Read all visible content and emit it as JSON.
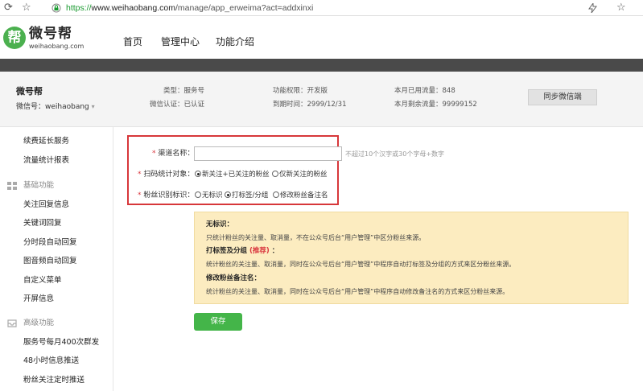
{
  "browser": {
    "back_glyph": "⟳",
    "star_glyph": "☆",
    "url_https": "https://",
    "url_host": "www.weihaobang.com",
    "url_path": "/manage/app_erweima?act=addxinxi",
    "icons": [
      "refresh-icon",
      "bookmark-star-icon",
      "secure-lock-icon",
      "share-icon",
      "star-icon"
    ]
  },
  "header": {
    "logo_glyph": "帮",
    "logo_name": "微号帮",
    "logo_sub": "weihaobang.com",
    "nav": [
      "首页",
      "管理中心",
      "功能介绍"
    ]
  },
  "account": {
    "name": "微号帮",
    "wechat_id": "微信号：weihaobang",
    "type": "类型：服务号",
    "verify": "微信认证：已认证",
    "permission": "功能权限：开发版",
    "expire": "到期时间：2999/12/31",
    "used_traffic": "本月已用流量：848",
    "remain_traffic": "本月剩余流量：99999152",
    "sync_button": "同步微信端"
  },
  "sidebar": {
    "top_items": [
      "续费延长服务",
      "流量统计报表"
    ],
    "group_basic": "基础功能",
    "basic_items": [
      "关注回复信息",
      "关键词回复",
      "分时段自动回复",
      "图音频自动回复",
      "自定义菜单",
      "开屏信息"
    ],
    "group_advanced": "高级功能",
    "advanced_items": [
      "服务号每月400次群发",
      "48小时信息推送",
      "粉丝关注定时推送"
    ]
  },
  "form": {
    "channel_label": "渠道名称：",
    "channel_value": "",
    "channel_hint": "不超过10个汉字或30个字母+数字",
    "target_label": "扫码统计对象：",
    "target_options": [
      "新关注+已关注的粉丝",
      "仅新关注的粉丝"
    ],
    "target_selected": 0,
    "mark_label": "粉丝识别标识：",
    "mark_options": [
      "无标识",
      "打标签/分组",
      "修改粉丝备注名"
    ],
    "mark_selected": 1,
    "required_mark": "*"
  },
  "explain": {
    "h1": "无标识：",
    "t1": "只统计粉丝的关注量、取消量，不在公众号后台“用户管理”中区分粉丝来源。",
    "h2": "打标签及分组",
    "h2_rec": "(推荐)",
    "h2_colon": "：",
    "t2": "统计粉丝的关注量、取消量，同时在公众号后台“用户管理”中程序自动打标签及分组的方式来区分粉丝来源。",
    "h3": "修改粉丝备注名：",
    "t3": "统计粉丝的关注量、取消量，同时在公众号后台“用户管理”中程序自动修改备注名的方式来区分粉丝来源。"
  },
  "save_button": "保存",
  "colors": {
    "accent_green": "#44b549",
    "required_red": "#d9363e",
    "panel_yellow": "#fcecc0",
    "highlight_border": "#d7373a"
  }
}
